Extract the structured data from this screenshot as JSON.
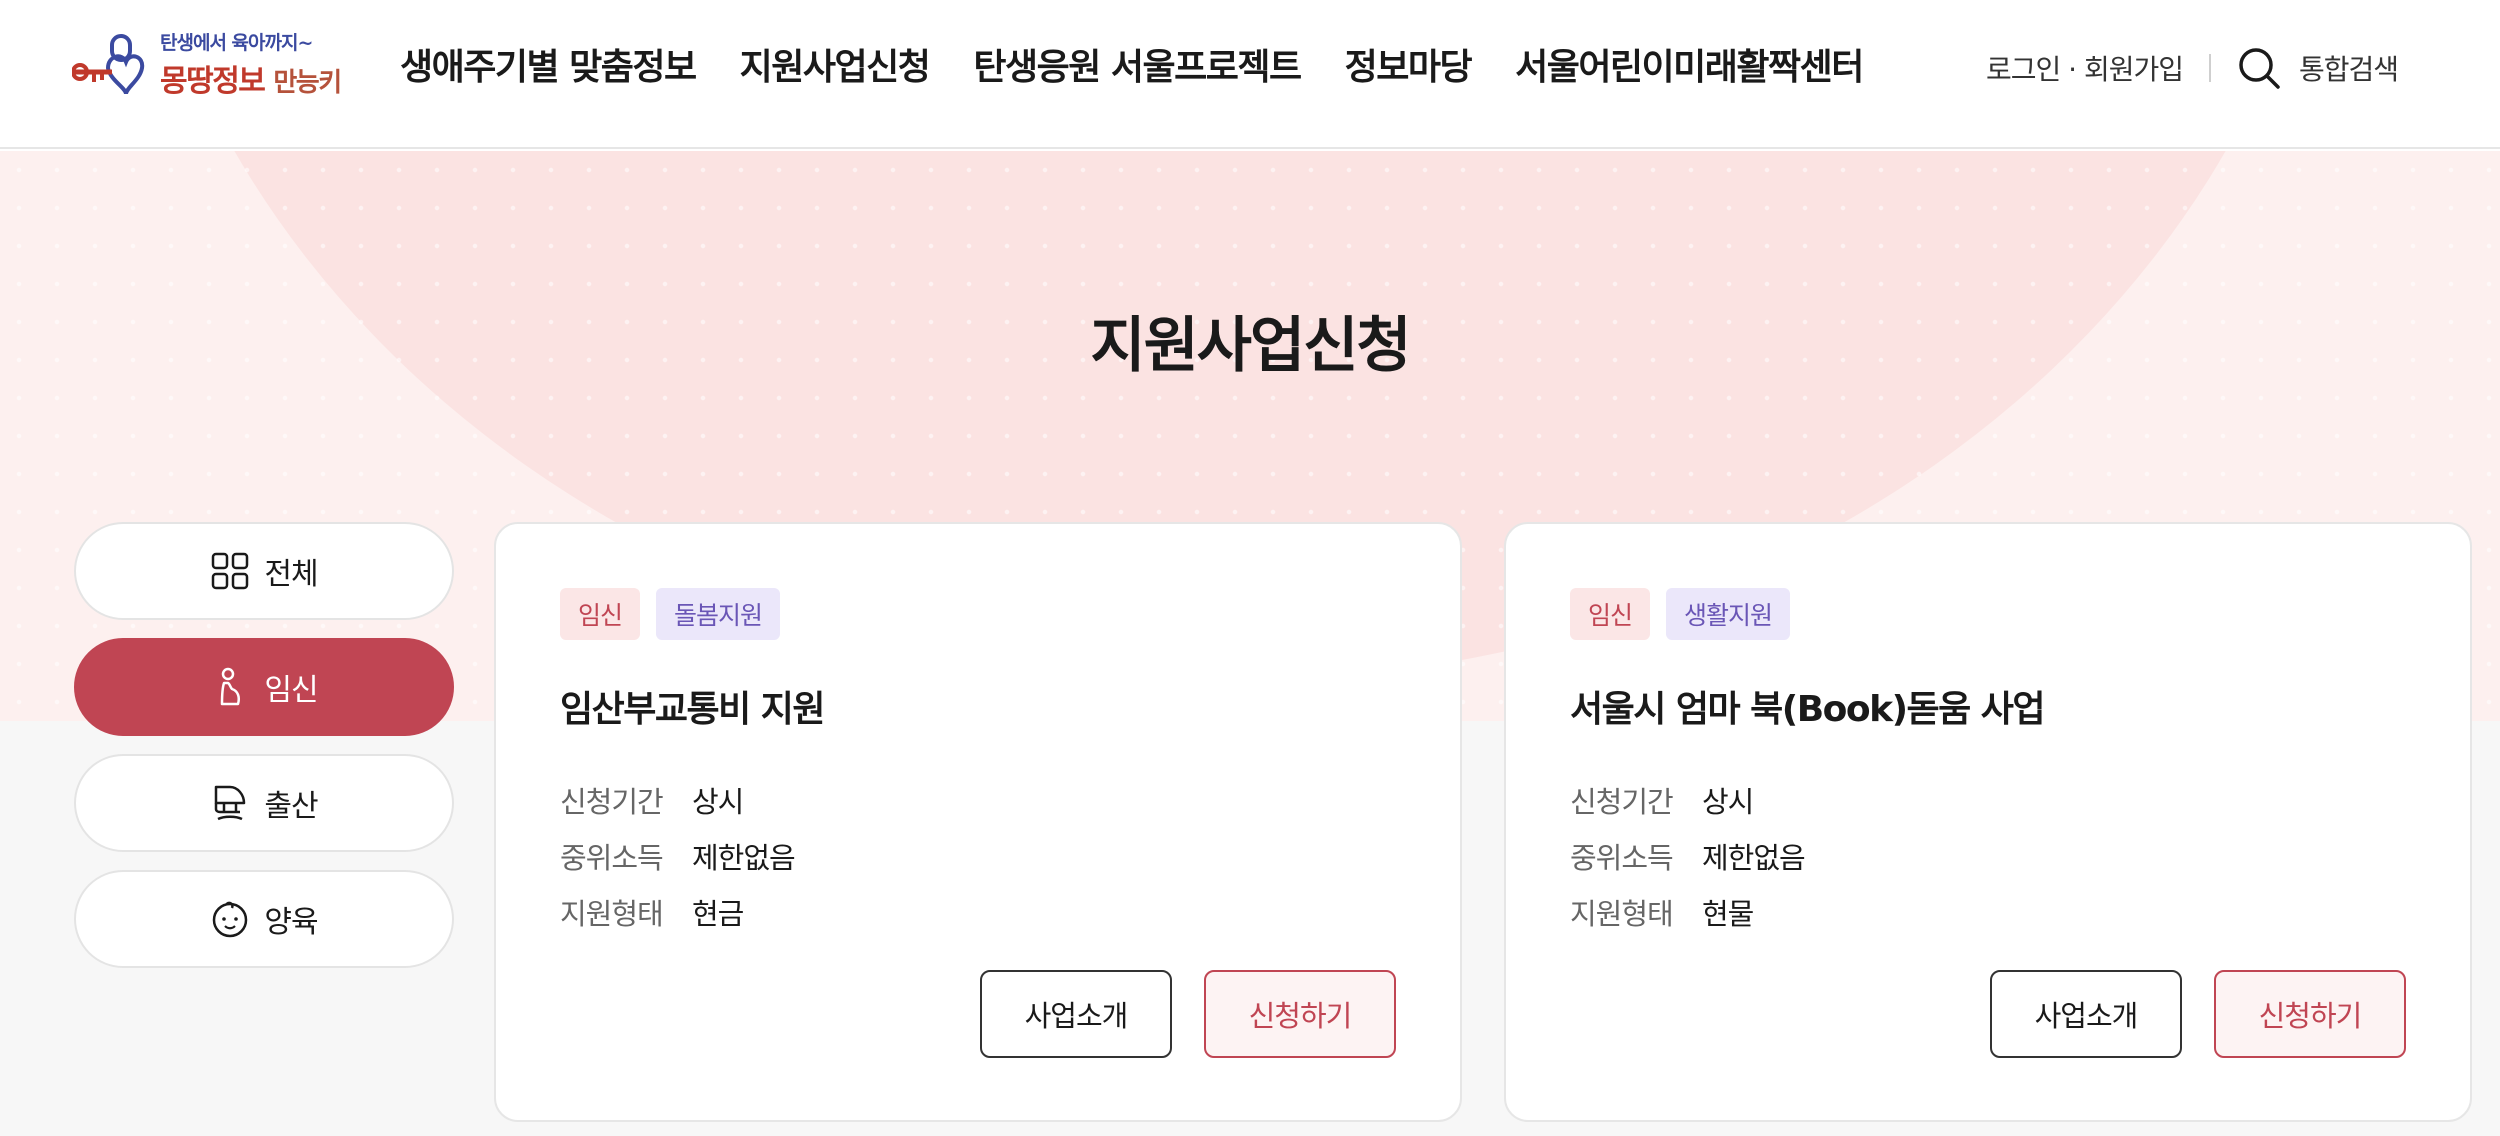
{
  "header": {
    "logo": {
      "small": "탄생에서 육아까지~",
      "main": "몽땅정보",
      "sub": "만능키"
    },
    "nav": [
      "생애주기별 맞춤정보",
      "지원사업신청",
      "탄생응원 서울프로젝트",
      "정보마당",
      "서울어린이미래활짝센터"
    ],
    "login": "로그인 · 회원가입",
    "search": "통합검색"
  },
  "hero": {
    "title": "지원사업신청"
  },
  "sidebar": {
    "items": [
      {
        "label": "전체",
        "icon": "grid-icon",
        "active": false
      },
      {
        "label": "임신",
        "icon": "pregnant-icon",
        "active": true
      },
      {
        "label": "출산",
        "icon": "stroller-icon",
        "active": false
      },
      {
        "label": "양육",
        "icon": "baby-face-icon",
        "active": false
      }
    ]
  },
  "cards": [
    {
      "tags": [
        "임신",
        "돌봄지원"
      ],
      "title": "임산부교통비 지원",
      "rows": [
        {
          "key": "신청기간",
          "value": "상시"
        },
        {
          "key": "중위소득",
          "value": "제한없음"
        },
        {
          "key": "지원형태",
          "value": "현금"
        }
      ],
      "intro_label": "사업소개",
      "apply_label": "신청하기"
    },
    {
      "tags": [
        "임신",
        "생활지원"
      ],
      "title": "서울시 엄마 북(Book)돋움 사업",
      "rows": [
        {
          "key": "신청기간",
          "value": "상시"
        },
        {
          "key": "중위소득",
          "value": "제한없음"
        },
        {
          "key": "지원형태",
          "value": "현물"
        }
      ],
      "intro_label": "사업소개",
      "apply_label": "신청하기"
    }
  ],
  "colors": {
    "accent": "#c04553",
    "hero_bg": "#fdf0ef",
    "tag_purple": "#6a56b6"
  }
}
